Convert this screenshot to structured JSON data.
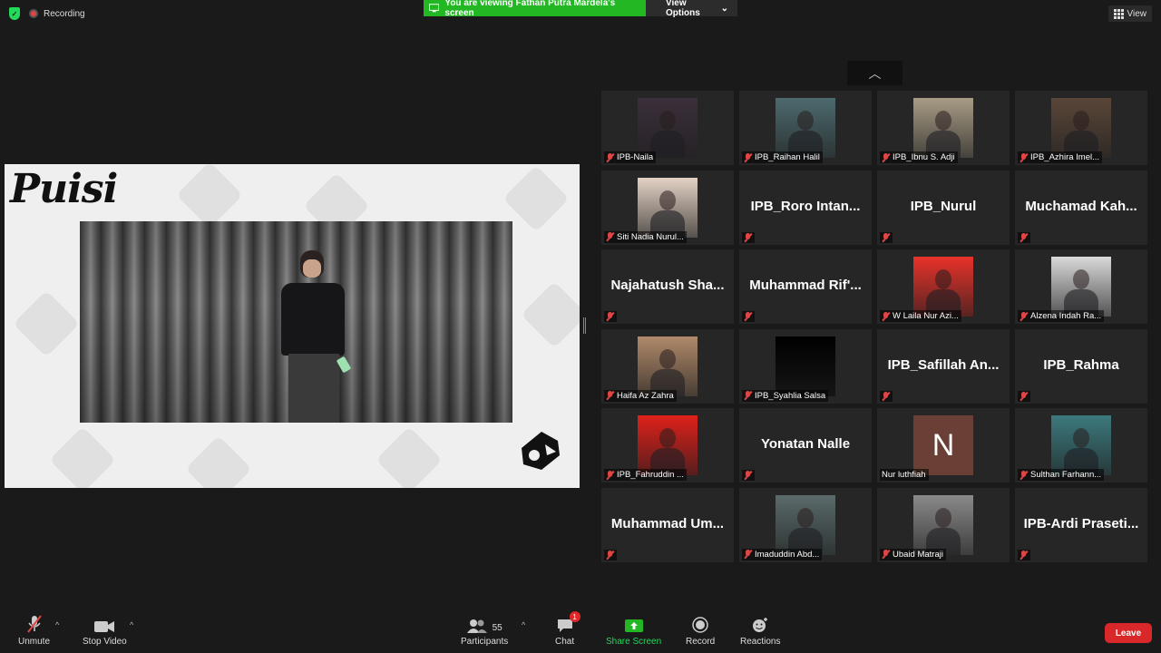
{
  "status": {
    "recording_label": "Recording",
    "share_banner_text": "You are viewing Fathan Putra Mardela's screen",
    "view_options_label": "View Options",
    "view_label": "View"
  },
  "shared_screen": {
    "title": "Puisi"
  },
  "gallery": {
    "tiles": [
      {
        "name": "IPB-Naila",
        "display": "photo",
        "photo_color": "#3a2f3a"
      },
      {
        "name": "IPB_Raihan Halil",
        "display": "photo",
        "photo_color": "#4d6a6e"
      },
      {
        "name": "IPB_Ibnu S. Adji",
        "display": "photo",
        "photo_color": "#a89c86"
      },
      {
        "name": "IPB_Azhira Imel...",
        "display": "photo",
        "photo_color": "#5a4638"
      },
      {
        "name": "Siti Nadia Nurul...",
        "display": "photo",
        "photo_color": "#e3d2c4"
      },
      {
        "name": "IPB_Roro Intan...",
        "display": "text"
      },
      {
        "name": "IPB_Nurul",
        "display": "text"
      },
      {
        "name": "Muchamad Kah...",
        "display": "text"
      },
      {
        "name": "Najahatush Sha...",
        "display": "text"
      },
      {
        "name": "Muhammad Rif'...",
        "display": "text"
      },
      {
        "name": "W Laila Nur Azi...",
        "display": "photo",
        "photo_color": "#e8322a"
      },
      {
        "name": "Alzena Indah Ra...",
        "display": "photo",
        "photo_color": "#d9d9d9"
      },
      {
        "name": "Haifa Az Zahra",
        "display": "photo",
        "photo_color": "#b08a6a"
      },
      {
        "name": "IPB_Syahlia Salsa",
        "display": "photo",
        "photo_color": "#000000"
      },
      {
        "name": "IPB_Safillah An...",
        "display": "text"
      },
      {
        "name": "IPB_Rahma",
        "display": "text"
      },
      {
        "name": "IPB_Fahruddin ...",
        "display": "photo",
        "photo_color": "#e0201a"
      },
      {
        "name": "Yonatan Nalle",
        "display": "text"
      },
      {
        "name": "Nur luthfiah",
        "display": "avatar",
        "initial": "N"
      },
      {
        "name": "Sulthan Farhann...",
        "display": "photo",
        "photo_color": "#3c7a7e"
      },
      {
        "name": "Muhammad Um...",
        "display": "text"
      },
      {
        "name": "Imaduddin Abd...",
        "display": "photo",
        "photo_color": "#5a6a6a"
      },
      {
        "name": "Ubaid Matraji",
        "display": "photo",
        "photo_color": "#8a8a8a"
      },
      {
        "name": "IPB-Ardi Praseti...",
        "display": "text"
      }
    ]
  },
  "toolbar": {
    "unmute_label": "Unmute",
    "stop_video_label": "Stop Video",
    "participants_label": "Participants",
    "participants_count": "55",
    "chat_label": "Chat",
    "chat_badge": "1",
    "share_screen_label": "Share Screen",
    "record_label": "Record",
    "reactions_label": "Reactions",
    "leave_label": "Leave"
  },
  "colors": {
    "share_green": "#23b823",
    "leave_red": "#d9282a",
    "muted_red": "#e04545"
  }
}
